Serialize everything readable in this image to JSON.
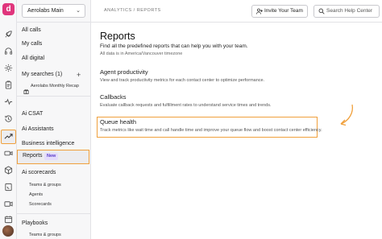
{
  "workspace": {
    "name": "Aerolabs Main"
  },
  "sidebar": {
    "items": [
      {
        "label": "All calls"
      },
      {
        "label": "My calls"
      },
      {
        "label": "All digital"
      },
      {
        "label": "My searches (1)"
      },
      {
        "label": "Aerolabs Monthly Recap"
      },
      {
        "label": "Ai CSAT"
      },
      {
        "label": "Ai Assistants"
      },
      {
        "label": "Business intelligence"
      },
      {
        "label": "Reports"
      },
      {
        "label": "Ai scorecards"
      },
      {
        "label": "Teams & groups"
      },
      {
        "label": "Agents"
      },
      {
        "label": "Scorecards"
      },
      {
        "label": "Playbooks"
      },
      {
        "label": "Teams & groups"
      }
    ],
    "reports_badge": "New",
    "add_symbol": "+"
  },
  "header": {
    "breadcrumb": "ANALYTICS / REPORTS",
    "invite_label": "Invite Your Team",
    "search_placeholder": "Search Help Center"
  },
  "main": {
    "title": "Reports",
    "subtitle": "Find all the predefined reports that can help you with your team.",
    "timezone": "All data is in America/Vancouver timezone",
    "reports": [
      {
        "title": "Agent productivity",
        "description": "View and track productivity metrics for each contact center to optimize performance."
      },
      {
        "title": "Callbacks",
        "description": "Evaluate callback requests and fulfillment rates to understand service times and trends."
      },
      {
        "title": "Queue health",
        "description": "Track metrics like wait time and call handle time and improve your queue flow and boost contact center efficiency."
      }
    ]
  },
  "colors": {
    "highlight": "#f0a03c",
    "brand": "#e0357c",
    "badge_bg": "#e4dcfb",
    "badge_text": "#5a3cc9"
  },
  "icons": [
    "logo-icon",
    "rocket-icon",
    "headset-icon",
    "gear-icon",
    "clipboard-icon",
    "pulse-icon",
    "history-icon",
    "trend-icon",
    "video-icon",
    "box-icon",
    "phone-book-icon",
    "camera-icon",
    "calendar-icon",
    "doc-icon",
    "gift-icon",
    "user-plus-icon",
    "search-icon",
    "chevron-down-icon"
  ]
}
